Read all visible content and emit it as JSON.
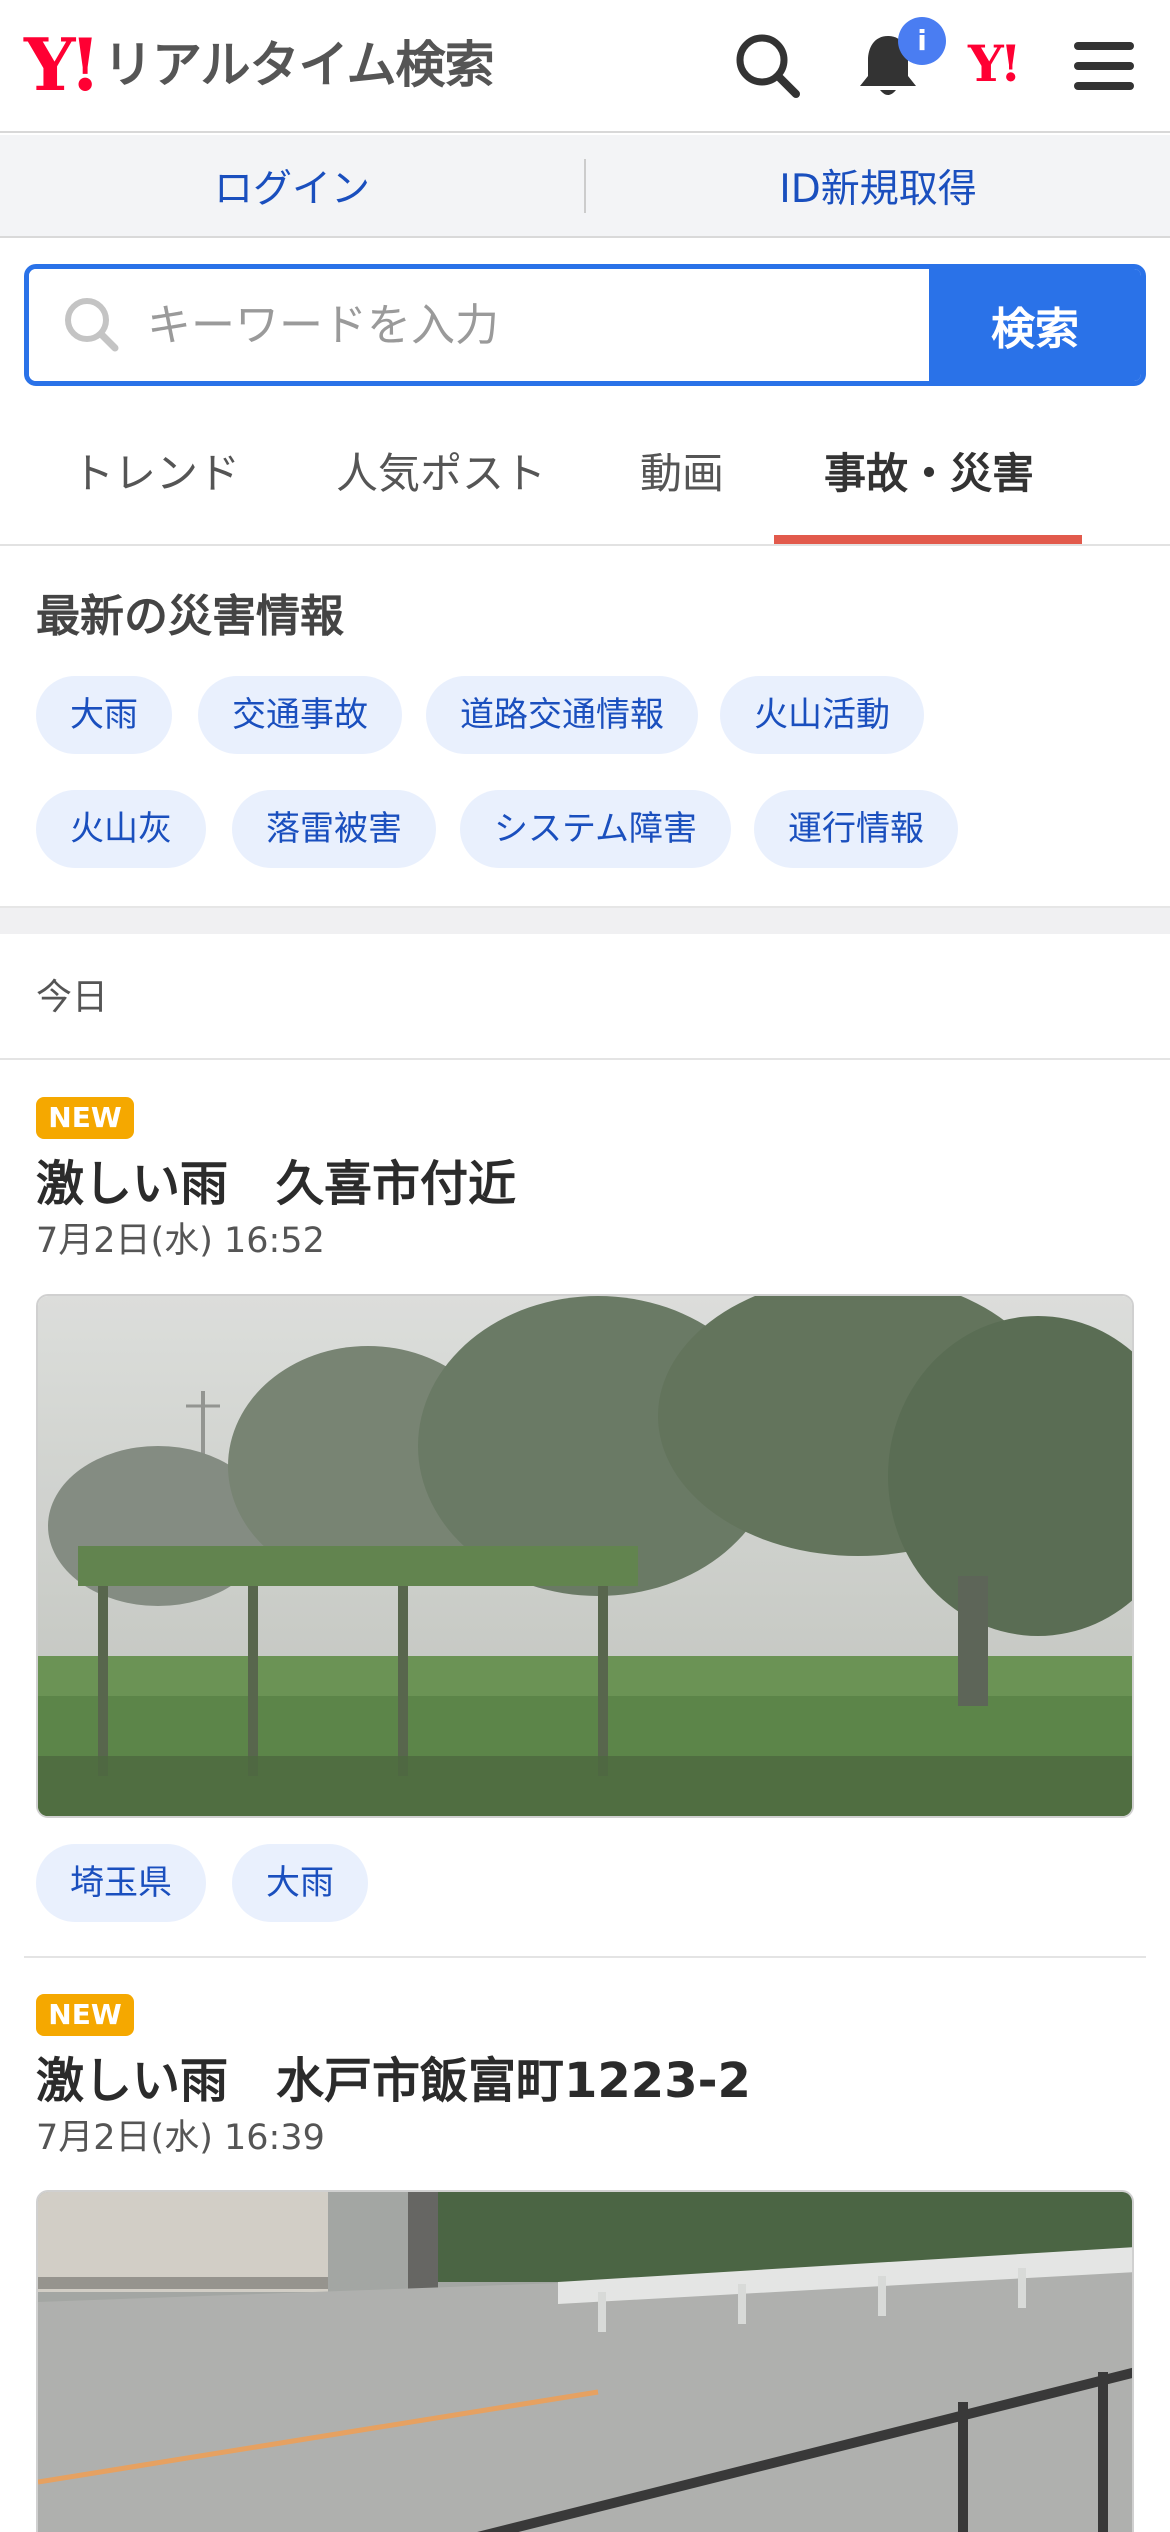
{
  "header": {
    "logo_mark": "Y!",
    "logo_text": "リアルタイム検索",
    "notification_badge": "i",
    "yahoo_mark": "Y!"
  },
  "account": {
    "login": "ログイン",
    "signup": "ID新規取得"
  },
  "search": {
    "placeholder": "キーワードを入力",
    "button": "検索"
  },
  "tabs": [
    "トレンド",
    "人気ポスト",
    "動画",
    "事故・災害"
  ],
  "disaster": {
    "title": "最新の災害情報",
    "chips": [
      "大雨",
      "交通事故",
      "道路交通情報",
      "火山活動",
      "火山灰",
      "落雷被害",
      "システム障害",
      "運行情報"
    ]
  },
  "day_label": "今日",
  "posts": [
    {
      "badge": "NEW",
      "title": "激しい雨　久喜市付近",
      "time": "7月2日(水) 16:52",
      "tags": [
        "埼玉県",
        "大雨"
      ]
    },
    {
      "badge": "NEW",
      "title": "激しい雨　水戸市飯富町1223-2",
      "time": "7月2日(水) 16:39"
    }
  ],
  "colors": {
    "brand_red": "#ff0033",
    "accent_blue": "#2a72e8",
    "link_blue": "#1a4fbe",
    "tab_underline": "#e25a4c",
    "new_badge": "#f5a800"
  }
}
